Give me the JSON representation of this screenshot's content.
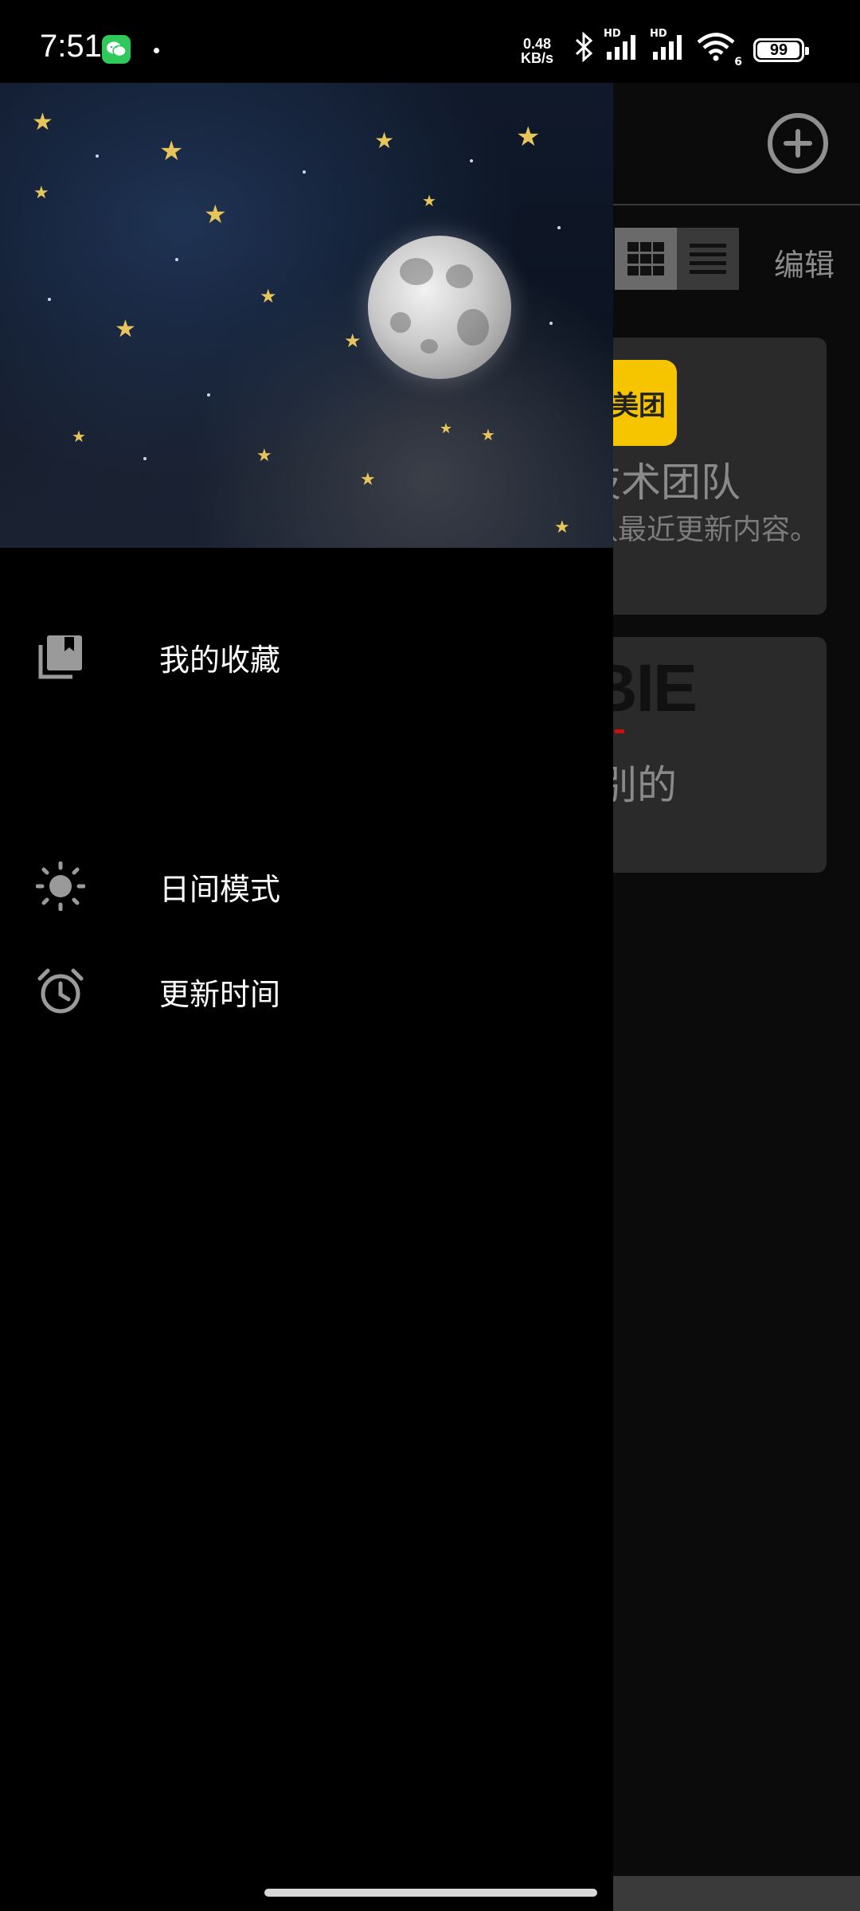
{
  "status_bar": {
    "time": "7:51",
    "network_speed_value": "0.48",
    "network_speed_unit": "KB/s",
    "battery": "99",
    "battery_level_percent": 99,
    "icons": [
      "wechat-icon",
      "bluetooth-icon",
      "signal-hd-icon",
      "signal-hd-icon",
      "wifi-icon",
      "battery-icon"
    ],
    "hd_label": "HD",
    "wifi_badge": "6"
  },
  "main": {
    "edit_label": "编辑",
    "cards": [
      {
        "logo_text": "美团",
        "title": "技术团队",
        "description": "队最近更新内容。"
      },
      {
        "logo_text": "BIE",
        "title": "别的"
      }
    ]
  },
  "drawer": {
    "items": [
      {
        "label": "我的收藏",
        "icon": "bookmark-collection-icon"
      },
      {
        "label": "日间模式",
        "icon": "sun-icon"
      },
      {
        "label": "更新时间",
        "icon": "alarm-clock-icon"
      }
    ]
  },
  "colors": {
    "background": "#000000",
    "drawer_background": "#000000",
    "meituan_yellow": "#f7c400",
    "card_background": "#2a2a2a",
    "star_yellow": "#e8c55a"
  }
}
